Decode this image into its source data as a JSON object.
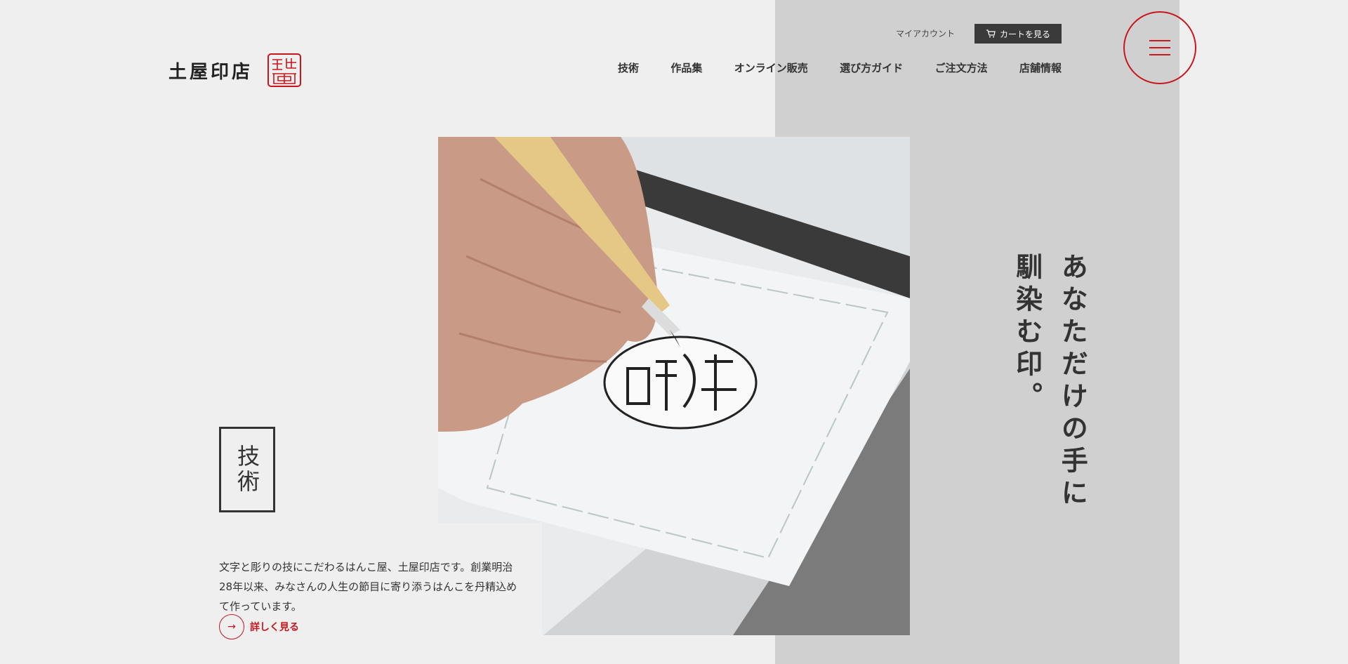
{
  "brand": {
    "logo_text": "土屋印店",
    "seal_icon": "red-seal-stamp"
  },
  "header": {
    "account_label": "マイアカウント",
    "cart_label": "カートを見る",
    "cart_icon": "cart-icon"
  },
  "nav": {
    "items": [
      "技術",
      "作品集",
      "オンライン販売",
      "選び方ガイド",
      "ご注文方法",
      "店舗情報"
    ]
  },
  "hero": {
    "catchphrase": "あなただけの手に馴染む印。",
    "section_label": "技術",
    "description": "文字と彫りの技にこだわるはんこ屋、土屋印店です。創業明治28年以来、みなさんの人生の節目に寄り添うはんこを丹精込めて作っています。",
    "more_label": "詳しく見る"
  },
  "colors": {
    "accent": "#c8161d",
    "background": "#efefef",
    "panel": "#d0d0d0",
    "text": "#333333"
  }
}
